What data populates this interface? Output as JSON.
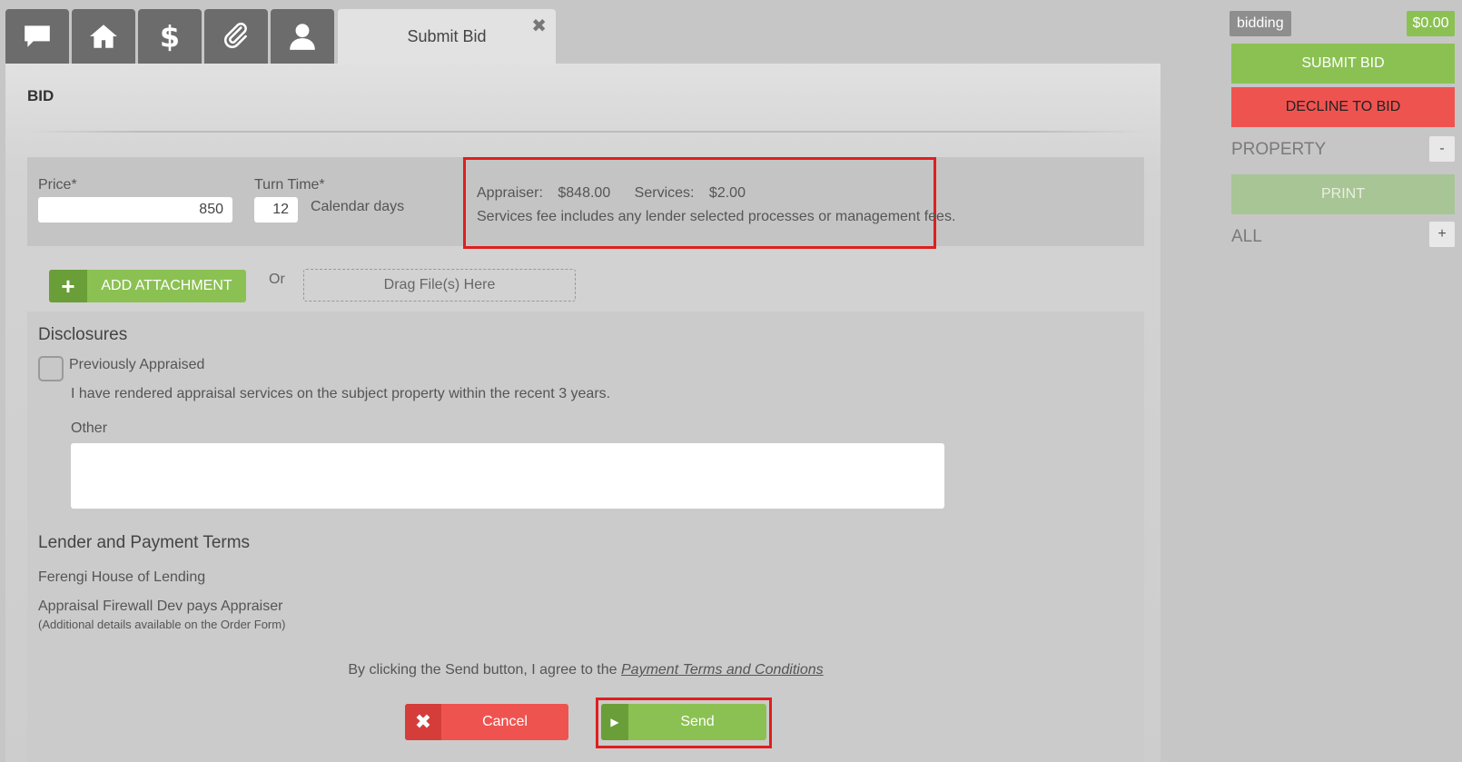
{
  "tabs": {
    "icons": [
      "chat-icon",
      "home-icon",
      "dollar-icon",
      "paperclip-icon",
      "user-icon"
    ],
    "active_label": "Submit Bid",
    "close_glyph": "✖"
  },
  "bid": {
    "section_title": "BID",
    "price_label": "Price*",
    "price_value": "850",
    "turn_time_label": "Turn Time*",
    "turn_time_value": "12",
    "turn_time_unit": "Calendar days",
    "appraiser_label": "Appraiser:",
    "appraiser_amount": "$848.00",
    "services_label": "Services:",
    "services_amount": "$2.00",
    "fee_note": "Services fee includes any lender selected processes or management fees."
  },
  "attachment": {
    "button_label": "ADD ATTACHMENT",
    "or_text": "Or",
    "drop_label": "Drag File(s) Here"
  },
  "disclosures": {
    "title": "Disclosures",
    "previously_appraised_label": "Previously Appraised",
    "previously_appraised_desc": "I have rendered appraisal services on the subject property within the recent 3 years.",
    "other_label": "Other",
    "other_value": ""
  },
  "lender": {
    "title": "Lender and Payment Terms",
    "name": "Ferengi House of Lending",
    "payer": "Appraisal Firewall Dev pays Appraiser",
    "payer_note": "(Additional details available on the Order Form)"
  },
  "agreement": {
    "text": "By clicking the Send button, I agree to the",
    "link": "Payment Terms and Conditions"
  },
  "actions": {
    "cancel_label": "Cancel",
    "send_label": "Send"
  },
  "sidebar": {
    "status": "bidding",
    "amount": "$0.00",
    "submit_label": "SUBMIT BID",
    "decline_label": "DECLINE TO BID",
    "property_label": "PROPERTY",
    "property_toggle": "-",
    "print_label": "PRINT",
    "all_label": "ALL",
    "all_toggle": "+"
  },
  "colors": {
    "accent_green": "#8bc152",
    "accent_red": "#ef5350",
    "highlight_border": "#e01e1e"
  }
}
